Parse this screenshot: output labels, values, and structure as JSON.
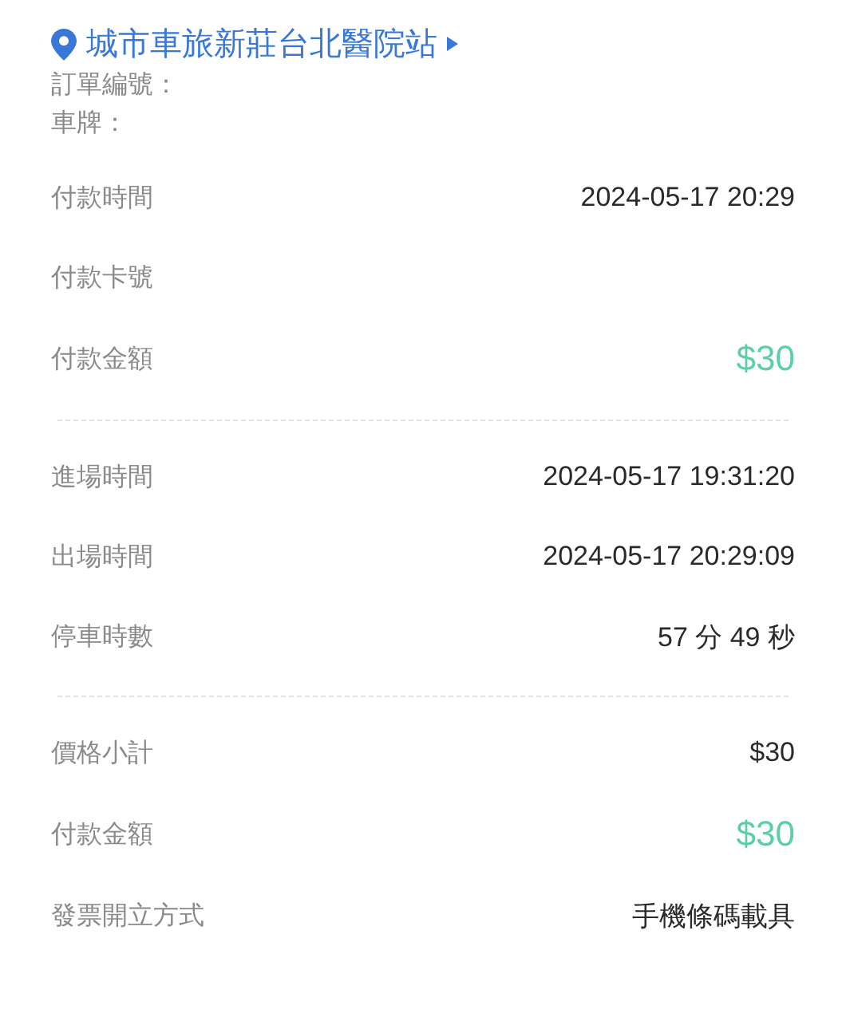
{
  "station": {
    "name": "城市車旅新莊台北醫院站"
  },
  "order_info": [
    "訂單編號：",
    "車牌："
  ],
  "sections": [
    {
      "rows": [
        {
          "label": "付款時間",
          "value": "2024-05-17 20:29",
          "kind": "plain"
        },
        {
          "label": "付款卡號",
          "kind": "plain"
        },
        {
          "label": "付款金額",
          "value": "$30",
          "kind": "amount"
        }
      ]
    },
    {
      "rows": [
        {
          "label": "進場時間",
          "value": "2024-05-17 19:31:20",
          "kind": "plain"
        },
        {
          "label": "出場時間",
          "value": "2024-05-17 20:29:09",
          "kind": "plain"
        },
        {
          "label": "停車時數",
          "value": "57 分 49 秒",
          "kind": "plain"
        }
      ]
    },
    {
      "rows": [
        {
          "label": "價格小計",
          "value": "$30",
          "kind": "plain"
        },
        {
          "label": "付款金額",
          "value": "$30",
          "kind": "amount"
        },
        {
          "label": "發票開立方式",
          "value": "手機條碼載具",
          "kind": "plain"
        }
      ]
    }
  ]
}
